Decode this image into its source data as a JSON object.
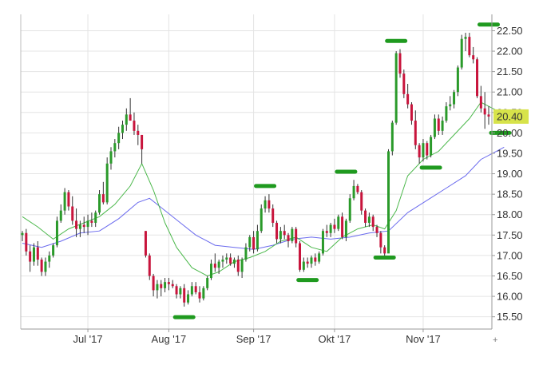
{
  "chart_data": {
    "type": "candlestick",
    "title": "",
    "xlabel": "",
    "ylabel": "",
    "ylim": [
      15.2,
      22.9
    ],
    "grid": true,
    "legend": "none",
    "y_ticks": [
      15.5,
      16.0,
      16.5,
      17.0,
      17.5,
      18.0,
      18.5,
      19.0,
      19.5,
      20.0,
      20.5,
      21.0,
      21.5,
      22.0,
      22.5
    ],
    "y_tick_labels": [
      "15.50",
      "16.00",
      "16.50",
      "17.00",
      "17.50",
      "18.00",
      "18.50",
      "19.00",
      "19.50",
      "20.00",
      "20.50",
      "21.00",
      "21.50",
      "22.00",
      "22.50"
    ],
    "x_ticks": [
      {
        "label": "Jul '17",
        "index": 17
      },
      {
        "label": "Aug '17",
        "index": 38
      },
      {
        "label": "Sep '17",
        "index": 60
      },
      {
        "label": "Okt '17",
        "index": 81
      },
      {
        "label": "Nov '17",
        "index": 104
      }
    ],
    "last_price": {
      "label": "20.40",
      "value": 20.4
    },
    "colors": {
      "up": "#2a9a2a",
      "down": "#c8143c",
      "ma_short": "#4cb84c",
      "ma_long": "#6a6aee",
      "grid": "#e4e4e4",
      "highlight": "#d7e34a",
      "marker": "#1f9a1f"
    },
    "candles": [
      [
        17.5,
        17.6,
        17.35,
        17.55
      ],
      [
        17.55,
        17.65,
        17.0,
        17.1
      ],
      [
        17.1,
        17.25,
        16.6,
        16.85
      ],
      [
        16.85,
        17.3,
        16.75,
        17.2
      ],
      [
        17.2,
        17.35,
        16.75,
        16.9
      ],
      [
        16.9,
        16.95,
        16.5,
        16.6
      ],
      [
        16.6,
        16.95,
        16.5,
        16.85
      ],
      [
        16.85,
        17.1,
        16.7,
        17.0
      ],
      [
        17.0,
        17.3,
        16.95,
        17.25
      ],
      [
        17.25,
        17.95,
        17.2,
        17.85
      ],
      [
        17.85,
        18.25,
        17.8,
        18.1
      ],
      [
        18.1,
        18.65,
        18.0,
        18.55
      ],
      [
        18.55,
        18.6,
        18.1,
        18.2
      ],
      [
        18.2,
        18.45,
        17.75,
        17.85
      ],
      [
        17.85,
        18.15,
        17.45,
        17.65
      ],
      [
        17.65,
        17.85,
        17.45,
        17.75
      ],
      [
        17.75,
        17.95,
        17.55,
        17.7
      ],
      [
        17.7,
        18.0,
        17.5,
        17.85
      ],
      [
        17.85,
        18.05,
        17.7,
        17.8
      ],
      [
        17.8,
        18.1,
        17.7,
        18.05
      ],
      [
        18.05,
        18.6,
        18.0,
        18.5
      ],
      [
        18.5,
        18.8,
        18.25,
        18.3
      ],
      [
        18.3,
        19.4,
        18.25,
        19.25
      ],
      [
        19.25,
        19.65,
        19.1,
        19.55
      ],
      [
        19.55,
        19.85,
        19.4,
        19.75
      ],
      [
        19.75,
        20.15,
        19.6,
        20.0
      ],
      [
        20.0,
        20.3,
        19.85,
        20.2
      ],
      [
        20.2,
        20.6,
        20.05,
        20.45
      ],
      [
        20.45,
        20.85,
        20.3,
        20.3
      ],
      [
        20.3,
        20.5,
        19.95,
        20.05
      ],
      [
        20.05,
        20.2,
        19.7,
        19.95
      ],
      [
        19.95,
        19.95,
        19.25,
        19.6
      ],
      [
        17.6,
        17.6,
        16.95,
        17.0
      ],
      [
        17.0,
        17.05,
        16.4,
        16.5
      ],
      [
        16.5,
        16.55,
        16.0,
        16.15
      ],
      [
        16.15,
        16.4,
        15.95,
        16.3
      ],
      [
        16.3,
        16.4,
        16.0,
        16.2
      ],
      [
        16.2,
        16.45,
        16.1,
        16.35
      ],
      [
        16.35,
        16.45,
        16.15,
        16.3
      ],
      [
        16.3,
        16.4,
        16.2,
        16.25
      ],
      [
        16.25,
        16.3,
        15.95,
        16.05
      ],
      [
        16.05,
        16.25,
        15.95,
        16.2
      ],
      [
        16.2,
        16.3,
        15.75,
        15.85
      ],
      [
        15.85,
        16.15,
        15.8,
        16.05
      ],
      [
        16.05,
        16.35,
        16.0,
        16.25
      ],
      [
        16.25,
        16.35,
        16.05,
        16.1
      ],
      [
        16.1,
        16.25,
        15.85,
        15.95
      ],
      [
        15.95,
        16.25,
        15.9,
        16.2
      ],
      [
        16.2,
        16.5,
        16.15,
        16.45
      ],
      [
        16.45,
        16.9,
        16.4,
        16.8
      ],
      [
        16.8,
        17.05,
        16.6,
        16.7
      ],
      [
        16.7,
        16.9,
        16.55,
        16.85
      ],
      [
        16.85,
        17.0,
        16.7,
        16.9
      ],
      [
        16.9,
        17.05,
        16.8,
        16.95
      ],
      [
        16.95,
        17.05,
        16.75,
        16.8
      ],
      [
        16.8,
        16.95,
        16.7,
        16.9
      ],
      [
        16.9,
        17.0,
        16.5,
        16.6
      ],
      [
        16.6,
        16.95,
        16.45,
        16.9
      ],
      [
        16.9,
        17.3,
        16.85,
        17.2
      ],
      [
        17.2,
        17.5,
        17.1,
        17.45
      ],
      [
        17.45,
        17.6,
        17.05,
        17.15
      ],
      [
        17.15,
        17.75,
        17.1,
        17.6
      ],
      [
        17.6,
        18.25,
        17.55,
        18.15
      ],
      [
        18.15,
        18.45,
        18.05,
        18.35
      ],
      [
        18.35,
        18.5,
        18.05,
        18.15
      ],
      [
        18.15,
        18.25,
        17.7,
        17.8
      ],
      [
        17.8,
        17.85,
        17.3,
        17.4
      ],
      [
        17.4,
        17.7,
        17.3,
        17.6
      ],
      [
        17.6,
        17.75,
        17.4,
        17.5
      ],
      [
        17.5,
        17.55,
        17.2,
        17.35
      ],
      [
        17.35,
        17.7,
        17.3,
        17.65
      ],
      [
        17.65,
        17.7,
        17.2,
        17.3
      ],
      [
        17.3,
        17.35,
        16.6,
        16.65
      ],
      [
        16.65,
        16.95,
        16.6,
        16.85
      ],
      [
        16.85,
        16.95,
        16.7,
        16.8
      ],
      [
        16.8,
        17.0,
        16.7,
        16.95
      ],
      [
        16.95,
        17.05,
        16.75,
        16.85
      ],
      [
        16.85,
        17.1,
        16.8,
        17.05
      ],
      [
        17.05,
        17.65,
        17.0,
        17.6
      ],
      [
        17.6,
        17.75,
        17.45,
        17.55
      ],
      [
        17.55,
        17.8,
        17.45,
        17.75
      ],
      [
        17.75,
        17.9,
        17.55,
        17.65
      ],
      [
        17.65,
        18.0,
        17.6,
        17.95
      ],
      [
        17.95,
        18.05,
        17.4,
        17.45
      ],
      [
        17.45,
        17.9,
        17.35,
        17.85
      ],
      [
        17.85,
        18.5,
        17.8,
        18.4
      ],
      [
        18.4,
        18.85,
        18.35,
        18.7
      ],
      [
        18.7,
        18.75,
        18.5,
        18.55
      ],
      [
        18.55,
        18.6,
        18.0,
        18.1
      ],
      [
        18.1,
        18.15,
        17.7,
        17.8
      ],
      [
        17.8,
        18.05,
        17.7,
        17.95
      ],
      [
        17.95,
        18.0,
        17.6,
        17.7
      ],
      [
        17.7,
        17.75,
        17.45,
        17.55
      ],
      [
        17.55,
        17.6,
        17.05,
        17.2
      ],
      [
        17.2,
        17.25,
        16.95,
        17.05
      ],
      [
        17.05,
        19.6,
        18.85,
        19.55
      ],
      [
        19.55,
        20.3,
        19.45,
        20.25
      ],
      [
        20.25,
        22.0,
        20.2,
        21.95
      ],
      [
        21.95,
        22.05,
        21.35,
        21.45
      ],
      [
        21.45,
        21.55,
        20.85,
        20.95
      ],
      [
        20.95,
        21.2,
        20.6,
        20.7
      ],
      [
        20.7,
        20.75,
        20.2,
        20.3
      ],
      [
        20.3,
        20.55,
        19.6,
        19.7
      ],
      [
        19.7,
        19.75,
        19.25,
        19.4
      ],
      [
        19.4,
        19.85,
        19.3,
        19.75
      ],
      [
        19.75,
        19.8,
        19.35,
        19.45
      ],
      [
        19.45,
        19.95,
        19.4,
        19.9
      ],
      [
        19.9,
        20.45,
        19.85,
        20.35
      ],
      [
        20.35,
        20.45,
        19.95,
        20.05
      ],
      [
        20.05,
        20.4,
        19.95,
        20.3
      ],
      [
        20.3,
        20.75,
        20.25,
        20.65
      ],
      [
        20.65,
        20.9,
        20.55,
        20.7
      ],
      [
        20.7,
        21.05,
        20.6,
        21.0
      ],
      [
        21.0,
        21.65,
        20.9,
        21.6
      ],
      [
        21.6,
        22.4,
        21.55,
        22.3
      ],
      [
        22.3,
        22.45,
        22.0,
        22.35
      ],
      [
        22.35,
        22.45,
        21.85,
        21.9
      ],
      [
        21.9,
        22.1,
        21.7,
        21.8
      ],
      [
        21.8,
        21.85,
        20.85,
        20.9
      ],
      [
        20.9,
        21.15,
        20.5,
        20.6
      ],
      [
        20.6,
        21.0,
        20.1,
        20.45
      ],
      [
        20.45,
        20.65,
        20.2,
        20.4
      ]
    ],
    "ma_short": [
      [
        0,
        17.95
      ],
      [
        4,
        17.7
      ],
      [
        8,
        17.4
      ],
      [
        12,
        17.65
      ],
      [
        16,
        17.8
      ],
      [
        20,
        17.95
      ],
      [
        24,
        18.25
      ],
      [
        28,
        18.7
      ],
      [
        31,
        19.25
      ],
      [
        34,
        18.6
      ],
      [
        37,
        17.8
      ],
      [
        40,
        17.2
      ],
      [
        44,
        16.7
      ],
      [
        48,
        16.5
      ],
      [
        51,
        16.6
      ],
      [
        55,
        16.85
      ],
      [
        59,
        16.95
      ],
      [
        63,
        17.1
      ],
      [
        67,
        17.35
      ],
      [
        71,
        17.45
      ],
      [
        75,
        17.2
      ],
      [
        79,
        17.1
      ],
      [
        83,
        17.45
      ],
      [
        87,
        17.65
      ],
      [
        91,
        17.75
      ],
      [
        94,
        17.65
      ],
      [
        97,
        18.1
      ],
      [
        100,
        18.95
      ],
      [
        104,
        19.35
      ],
      [
        108,
        19.55
      ],
      [
        112,
        19.95
      ],
      [
        116,
        20.35
      ],
      [
        119,
        20.75
      ],
      [
        123,
        20.55
      ]
    ],
    "ma_long": [
      [
        0,
        17.3
      ],
      [
        5,
        17.2
      ],
      [
        10,
        17.35
      ],
      [
        15,
        17.55
      ],
      [
        20,
        17.6
      ],
      [
        25,
        17.9
      ],
      [
        30,
        18.3
      ],
      [
        33,
        18.4
      ],
      [
        37,
        18.1
      ],
      [
        41,
        17.8
      ],
      [
        45,
        17.5
      ],
      [
        50,
        17.25
      ],
      [
        55,
        17.2
      ],
      [
        60,
        17.15
      ],
      [
        65,
        17.25
      ],
      [
        70,
        17.4
      ],
      [
        75,
        17.45
      ],
      [
        80,
        17.4
      ],
      [
        85,
        17.45
      ],
      [
        90,
        17.55
      ],
      [
        95,
        17.6
      ],
      [
        100,
        18.05
      ],
      [
        105,
        18.35
      ],
      [
        110,
        18.65
      ],
      [
        115,
        18.95
      ],
      [
        119,
        19.35
      ],
      [
        123,
        19.55
      ],
      [
        125,
        19.65
      ]
    ],
    "markers": [
      {
        "index": 42,
        "value": 15.49
      },
      {
        "index": 63,
        "value": 18.7
      },
      {
        "index": 74,
        "value": 16.4
      },
      {
        "index": 84,
        "value": 19.05
      },
      {
        "index": 94,
        "value": 16.95
      },
      {
        "index": 97,
        "value": 22.25
      },
      {
        "index": 106,
        "value": 19.15
      },
      {
        "index": 121,
        "value": 22.65
      },
      {
        "index": 124,
        "value": 20.0
      }
    ]
  }
}
